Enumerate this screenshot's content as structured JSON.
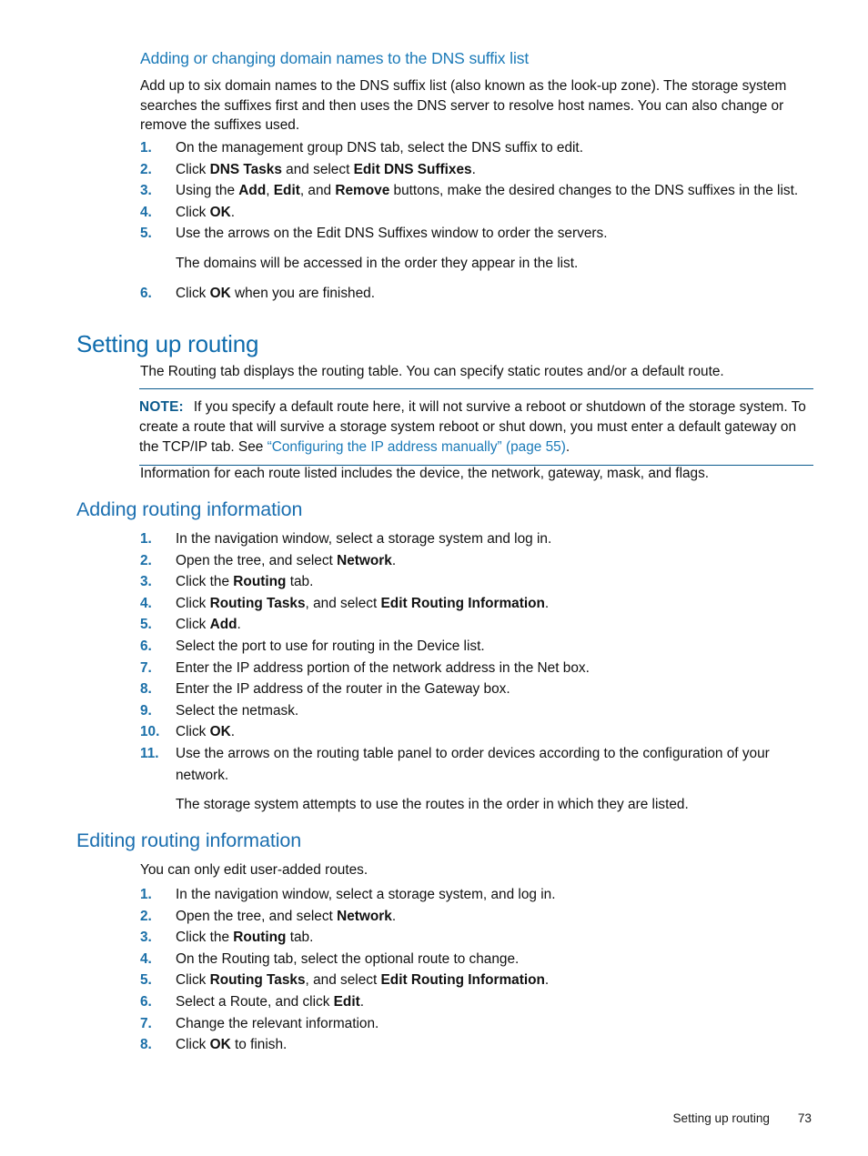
{
  "colors": {
    "heading_blue": "#0f6cad",
    "subheading_blue": "#1b6fb0",
    "minor_heading_blue": "#1b7ab8",
    "list_number_blue": "#1a6fa8",
    "note_rule_blue": "#0b5a8d",
    "xref_blue": "#1b7ab8",
    "body_text": "#111111"
  },
  "section_dns": {
    "heading": "Adding or changing domain names to the DNS suffix list",
    "intro": "Add up to six domain names to the DNS suffix list (also known as the look-up zone). The storage system searches the suffixes first and then uses the DNS server to resolve host names. You can also change or remove the suffixes used.",
    "steps": [
      {
        "num": "1.",
        "parts": [
          {
            "t": "On the management group DNS tab, select the DNS suffix to edit."
          }
        ]
      },
      {
        "num": "2.",
        "parts": [
          {
            "t": "Click "
          },
          {
            "t": "DNS Tasks",
            "b": true
          },
          {
            "t": " and select "
          },
          {
            "t": "Edit DNS Suffixes",
            "b": true
          },
          {
            "t": "."
          }
        ]
      },
      {
        "num": "3.",
        "parts": [
          {
            "t": "Using the "
          },
          {
            "t": "Add",
            "b": true
          },
          {
            "t": ", "
          },
          {
            "t": "Edit",
            "b": true
          },
          {
            "t": ", and "
          },
          {
            "t": "Remove",
            "b": true
          },
          {
            "t": " buttons, make the desired changes to the DNS suffixes in the list."
          }
        ]
      },
      {
        "num": "4.",
        "parts": [
          {
            "t": "Click "
          },
          {
            "t": "OK",
            "b": true
          },
          {
            "t": "."
          }
        ]
      },
      {
        "num": "5.",
        "parts": [
          {
            "t": "Use the arrows on the Edit DNS Suffixes window to order the servers."
          }
        ]
      }
    ],
    "step5_followup": "The domains will be accessed in the order they appear in the list.",
    "step6": {
      "num": "6.",
      "parts": [
        {
          "t": "Click "
        },
        {
          "t": "OK",
          "b": true
        },
        {
          "t": " when you are finished."
        }
      ]
    }
  },
  "section_routing": {
    "heading": "Setting up routing",
    "intro": "The Routing tab displays the routing table. You can specify static routes and/or a default route.",
    "note": {
      "label": "NOTE:",
      "parts": [
        {
          "t": "If you specify a default route here, it will not survive a reboot or shutdown of the storage system. To create a route that will survive a storage system reboot or shut down, you must enter a default gateway on the TCP/IP tab. See "
        },
        {
          "t": "“Configuring the IP address manually” (page 55)",
          "xref": true
        },
        {
          "t": "."
        }
      ]
    },
    "after_note": "Information for each route listed includes the device, the network, gateway, mask, and flags."
  },
  "section_adding": {
    "heading": "Adding routing information",
    "steps": [
      {
        "num": "1.",
        "parts": [
          {
            "t": "In the navigation window, select a storage system and log in."
          }
        ]
      },
      {
        "num": "2.",
        "parts": [
          {
            "t": "Open the tree, and select "
          },
          {
            "t": "Network",
            "b": true
          },
          {
            "t": "."
          }
        ]
      },
      {
        "num": "3.",
        "parts": [
          {
            "t": "Click the "
          },
          {
            "t": "Routing",
            "b": true
          },
          {
            "t": " tab."
          }
        ]
      },
      {
        "num": "4.",
        "parts": [
          {
            "t": "Click "
          },
          {
            "t": "Routing Tasks",
            "b": true
          },
          {
            "t": ", and select "
          },
          {
            "t": "Edit Routing Information",
            "b": true
          },
          {
            "t": "."
          }
        ]
      },
      {
        "num": "5.",
        "parts": [
          {
            "t": "Click "
          },
          {
            "t": "Add",
            "b": true
          },
          {
            "t": "."
          }
        ]
      },
      {
        "num": "6.",
        "parts": [
          {
            "t": "Select the port to use for routing in the Device list."
          }
        ]
      },
      {
        "num": "7.",
        "parts": [
          {
            "t": "Enter the IP address portion of the network address in the Net box."
          }
        ]
      },
      {
        "num": "8.",
        "parts": [
          {
            "t": "Enter the IP address of the router in the Gateway box."
          }
        ]
      },
      {
        "num": "9.",
        "parts": [
          {
            "t": "Select the netmask."
          }
        ]
      },
      {
        "num": "10.",
        "parts": [
          {
            "t": "Click "
          },
          {
            "t": "OK",
            "b": true
          },
          {
            "t": "."
          }
        ]
      },
      {
        "num": "11.",
        "parts": [
          {
            "t": "Use the arrows on the routing table panel to order devices according to the configuration of your network."
          }
        ]
      }
    ],
    "followup": "The storage system attempts to use the routes in the order in which they are listed."
  },
  "section_editing": {
    "heading": "Editing routing information",
    "intro": "You can only edit user-added routes.",
    "steps": [
      {
        "num": "1.",
        "parts": [
          {
            "t": "In the navigation window, select a storage system, and log in."
          }
        ]
      },
      {
        "num": "2.",
        "parts": [
          {
            "t": "Open the tree, and select "
          },
          {
            "t": "Network",
            "b": true
          },
          {
            "t": "."
          }
        ]
      },
      {
        "num": "3.",
        "parts": [
          {
            "t": "Click the "
          },
          {
            "t": "Routing",
            "b": true
          },
          {
            "t": " tab."
          }
        ]
      },
      {
        "num": "4.",
        "parts": [
          {
            "t": "On the Routing tab, select the optional route to change."
          }
        ]
      },
      {
        "num": "5.",
        "parts": [
          {
            "t": "Click "
          },
          {
            "t": "Routing Tasks",
            "b": true
          },
          {
            "t": ", and select "
          },
          {
            "t": "Edit Routing Information",
            "b": true
          },
          {
            "t": "."
          }
        ]
      },
      {
        "num": "6.",
        "parts": [
          {
            "t": "Select a Route, and click "
          },
          {
            "t": "Edit",
            "b": true
          },
          {
            "t": "."
          }
        ]
      },
      {
        "num": "7.",
        "parts": [
          {
            "t": "Change the relevant information."
          }
        ]
      },
      {
        "num": "8.",
        "parts": [
          {
            "t": "Click "
          },
          {
            "t": "OK",
            "b": true
          },
          {
            "t": " to finish."
          }
        ]
      }
    ]
  },
  "footer": {
    "title": "Setting up routing",
    "page": "73"
  }
}
